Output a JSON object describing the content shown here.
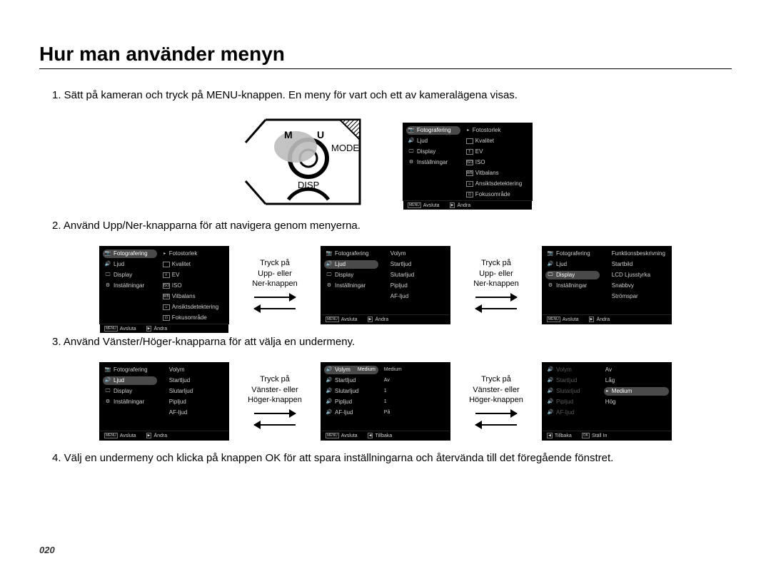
{
  "page": {
    "title": "Hur man använder menyn",
    "number": "020"
  },
  "steps": {
    "s1": "1. Sätt på kameran och tryck på MENU-knappen. En meny för vart och ett av kameralägena visas.",
    "s2": "2. Använd Upp/Ner-knapparna för att navigera genom menyerna.",
    "s3": "3. Använd Vänster/Höger-knapparna för att välja en undermeny.",
    "s4": "4. Välj en undermeny och klicka på knappen OK för att spara inställningarna och återvända till det föregående fönstret."
  },
  "camera": {
    "labels": {
      "menu_prefix": "M",
      "menu_suffix": "U",
      "mode": "MODE",
      "disp": "DISP"
    }
  },
  "connectors": {
    "up_down": "Tryck på\nUpp- eller\nNer-knappen",
    "left_right": "Tryck på\nVänster- eller\nHöger-knappen"
  },
  "left_menu": {
    "items": [
      {
        "label": "Fotografering"
      },
      {
        "label": "Ljud"
      },
      {
        "label": "Display"
      },
      {
        "label": "Inställningar"
      }
    ]
  },
  "sub_foto": {
    "items": [
      {
        "label": "Fotostorlek"
      },
      {
        "label": "Kvalitet"
      },
      {
        "label": "EV"
      },
      {
        "label": "ISO"
      },
      {
        "label": "Vitbalans"
      },
      {
        "label": "Ansiktsdetektering"
      },
      {
        "label": "Fokusområde"
      }
    ]
  },
  "sub_ljud": {
    "items": [
      {
        "label": "Volym"
      },
      {
        "label": "Startljud"
      },
      {
        "label": "Slutarljud"
      },
      {
        "label": "Pipljud"
      },
      {
        "label": "AF-ljud"
      }
    ]
  },
  "sub_display": {
    "items": [
      {
        "label": "Funktionsbeskrivning"
      },
      {
        "label": "Startbild"
      },
      {
        "label": "LCD Ljusstyrka"
      },
      {
        "label": "Snabbvy"
      },
      {
        "label": "Strömspar"
      }
    ]
  },
  "ljud_values": {
    "volym": "Medium",
    "startljud": "Av",
    "slutarljud": "1",
    "pipljud": "1",
    "af": "På"
  },
  "volym_options": {
    "items": [
      {
        "label": "Av"
      },
      {
        "label": "Låg"
      },
      {
        "label": "Medium"
      },
      {
        "label": "Hög"
      }
    ]
  },
  "footer": {
    "menu_key": "MENU",
    "icon_key": "▶",
    "back_key": "◀",
    "ok_key": "OK",
    "exit": "Avsluta",
    "change": "Ändra",
    "back": "Tillbaka",
    "set": "Ställ In"
  }
}
